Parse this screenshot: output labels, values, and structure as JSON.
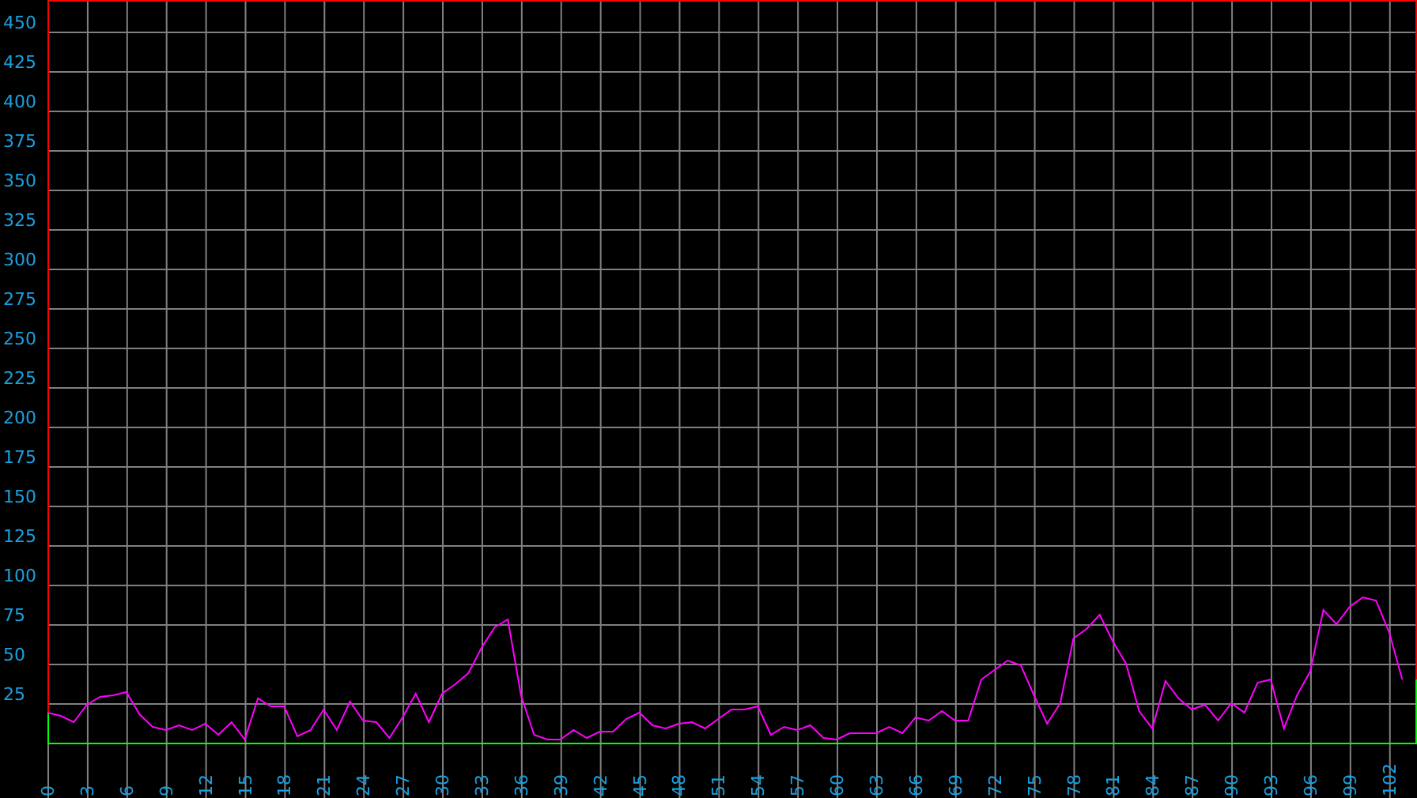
{
  "chart_data": {
    "type": "line",
    "grid": true,
    "xlim": [
      0,
      104
    ],
    "ylim": [
      0,
      470
    ],
    "x": [
      0,
      1,
      2,
      3,
      4,
      5,
      6,
      7,
      8,
      9,
      10,
      11,
      12,
      13,
      14,
      15,
      16,
      17,
      18,
      19,
      20,
      21,
      22,
      23,
      24,
      25,
      26,
      27,
      28,
      29,
      30,
      31,
      32,
      33,
      34,
      35,
      36,
      37,
      38,
      39,
      40,
      41,
      42,
      43,
      44,
      45,
      46,
      47,
      48,
      49,
      50,
      51,
      52,
      53,
      54,
      55,
      56,
      57,
      58,
      59,
      60,
      61,
      62,
      63,
      64,
      65,
      66,
      67,
      68,
      69,
      70,
      71,
      72,
      73,
      74,
      75,
      76,
      77,
      78,
      79,
      80,
      81,
      82,
      83,
      84,
      85,
      86,
      87,
      88,
      89,
      90,
      91,
      92,
      93,
      94,
      95,
      96,
      97,
      98,
      99,
      100,
      101,
      102,
      103
    ],
    "xticks": [
      {
        "value": 0,
        "label": "0"
      },
      {
        "value": 3,
        "label": "3"
      },
      {
        "value": 6,
        "label": "6"
      },
      {
        "value": 9,
        "label": "9"
      },
      {
        "value": 12,
        "label": "12"
      },
      {
        "value": 15,
        "label": "15"
      },
      {
        "value": 18,
        "label": "18"
      },
      {
        "value": 21,
        "label": "21"
      },
      {
        "value": 24,
        "label": "24"
      },
      {
        "value": 27,
        "label": "27"
      },
      {
        "value": 30,
        "label": "30"
      },
      {
        "value": 33,
        "label": "33"
      },
      {
        "value": 36,
        "label": "36"
      },
      {
        "value": 39,
        "label": "39"
      },
      {
        "value": 42,
        "label": "42"
      },
      {
        "value": 45,
        "label": "45"
      },
      {
        "value": 48,
        "label": "48"
      },
      {
        "value": 51,
        "label": "51"
      },
      {
        "value": 54,
        "label": "54"
      },
      {
        "value": 57,
        "label": "57"
      },
      {
        "value": 60,
        "label": "60"
      },
      {
        "value": 63,
        "label": "63"
      },
      {
        "value": 66,
        "label": "66"
      },
      {
        "value": 69,
        "label": "69"
      },
      {
        "value": 72,
        "label": "72"
      },
      {
        "value": 75,
        "label": "75"
      },
      {
        "value": 78,
        "label": "78"
      },
      {
        "value": 81,
        "label": "81"
      },
      {
        "value": 84,
        "label": "84"
      },
      {
        "value": 87,
        "label": "87"
      },
      {
        "value": 90,
        "label": "90"
      },
      {
        "value": 93,
        "label": "93"
      },
      {
        "value": 96,
        "label": "96"
      },
      {
        "value": 99,
        "label": "99"
      },
      {
        "value": 102,
        "label": "102"
      }
    ],
    "yticks": [
      25,
      50,
      75,
      100,
      125,
      150,
      175,
      200,
      225,
      250,
      275,
      300,
      325,
      350,
      375,
      400,
      425,
      450
    ],
    "series": [
      {
        "color": "#ff00ff",
        "values": [
          19,
          17,
          13,
          24,
          29,
          30,
          32,
          18,
          10,
          8,
          11,
          8,
          12,
          5,
          13,
          2,
          28,
          23,
          23,
          4,
          8,
          21,
          8,
          26,
          14,
          13,
          3,
          16,
          31,
          13,
          31,
          37,
          44,
          60,
          73,
          78,
          30,
          5,
          2,
          2,
          8,
          3,
          7,
          7,
          15,
          19,
          11,
          9,
          12,
          13,
          9,
          15,
          21,
          21,
          23,
          5,
          10,
          8,
          11,
          3,
          2,
          6,
          6,
          6,
          10,
          6,
          16,
          14,
          20,
          14,
          14,
          40,
          46,
          52,
          49,
          30,
          12,
          25,
          66,
          72,
          81,
          64,
          50,
          20,
          9,
          39,
          28,
          21,
          24,
          14,
          25,
          19,
          38,
          40,
          9,
          30,
          45,
          84,
          75,
          86,
          92,
          90,
          70,
          40
        ]
      }
    ]
  }
}
